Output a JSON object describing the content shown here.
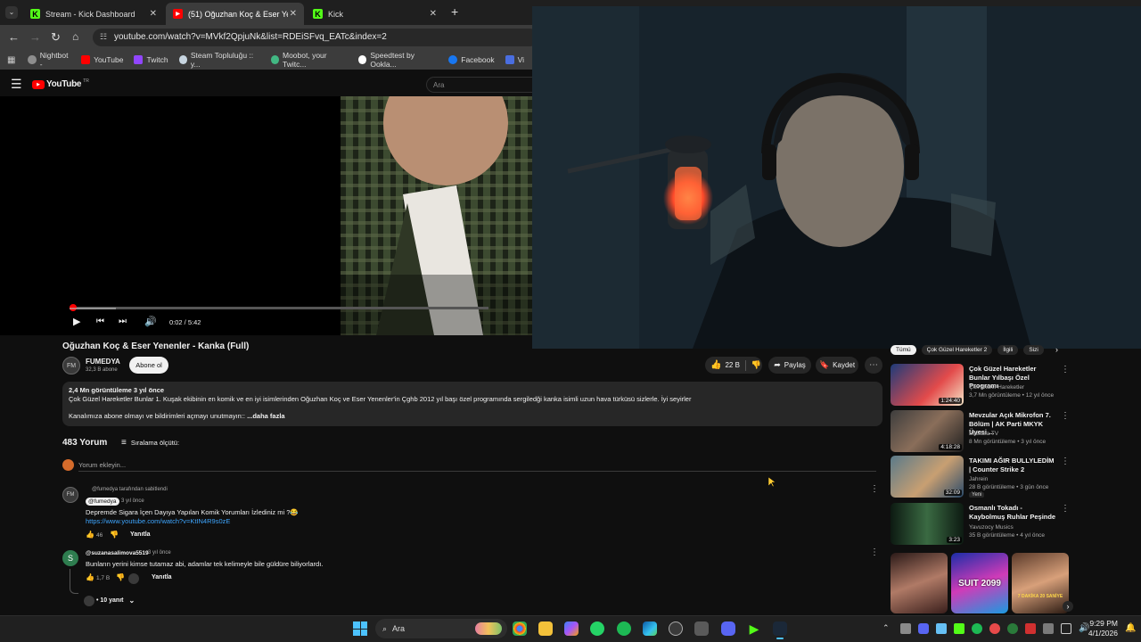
{
  "tabs": [
    {
      "label": "Stream - Kick Dashboard",
      "icon": "kick-icon"
    },
    {
      "label": "(51) Oğuzhan Koç & Eser Yenen",
      "icon": "youtube-icon"
    },
    {
      "label": "Kick",
      "icon": "kick-icon"
    }
  ],
  "new_tab": "+",
  "address": {
    "url": "youtube.com/watch?v=MVkf2QpjuNk&list=RDEiSFvq_EATc&index=2"
  },
  "bookmarks": [
    {
      "label": "Nightbot -",
      "color": "#8e8e8e"
    },
    {
      "label": "YouTube",
      "color": "#ff0000"
    },
    {
      "label": "Twitch",
      "color": "#9146ff"
    },
    {
      "label": "Steam Topluluğu :: y...",
      "color": "#c7d5e0"
    },
    {
      "label": "Moobot, your Twitc...",
      "color": "#42b883"
    },
    {
      "label": "Speedtest by Ookla...",
      "color": "#ffffff"
    },
    {
      "label": "Facebook",
      "color": "#1877f2"
    },
    {
      "label": "Vi",
      "color": "#4a6ee0"
    }
  ],
  "youtube": {
    "logo": "YouTube",
    "region": "TR",
    "search_placeholder": "Ara"
  },
  "player": {
    "time": "0:02 / 5:42",
    "progress": 0.006
  },
  "video": {
    "title": "Oğuzhan Koç & Eser Yenenler - Kanka (Full)",
    "channel": "FUMEDYA",
    "channel_avatar": "FM",
    "subscribers": "32,3 B abone",
    "subscribe": "Abone ol",
    "likes": "22 B",
    "share": "Paylaş",
    "save": "Kaydet",
    "desc_stats": "2,4 Mn görüntüleme  3 yıl önce",
    "desc_line1": "Çok Güzel Hareketler Bunlar 1. Kuşak ekibinin en komik ve en iyi isimlerinden Oğuzhan Koç ve Eser Yenenler'in Çghb 2012 yıl başı özel programında sergiledği kanka isimli uzun hava türküsü sizlerle. İyi seyirler",
    "desc_line2": "Kanalımıza abone olmayı ve bildirimleri açmayı unutmayın::  ",
    "desc_more": "...daha fazla"
  },
  "comments": {
    "count": "483 Yorum",
    "sort": "Sıralama ölçütü:",
    "add_placeholder": "Yorum ekleyin...",
    "items": [
      {
        "pinned": "@fumedya tarafından sabitlendi",
        "author": "@fumedya",
        "time": "3 yıl önce",
        "text": "Depremde Sigara İçen Dayıya Yapılan Komik Yorumları İzlediniz mi ?😂",
        "link": "https://www.youtube.com/watch?v=KtIN4R9s0zE",
        "likes": "46",
        "reply": "Yanıtla"
      },
      {
        "avatar": "S",
        "author": "@suzanasalimova5519",
        "time": "3 yıl önce",
        "text": "Bunların yerini kimse tutamaz abi, adamlar tek kelimeyle bile güldüre biliyorlardı.",
        "likes": "1,7 B",
        "reply": "Yanıtla",
        "replies": "• 10 yanıt"
      }
    ]
  },
  "chips": [
    "Tümü",
    "Çok Güzel Hareketler 2",
    "İlgili",
    "Sizi"
  ],
  "recommendations": [
    {
      "title": "Çok Güzel Hareketler Bunlar Yılbaşı Özel Programı",
      "channel": "Çok Güzel Hareketler",
      "meta": "3,7 Mn görüntüleme • 12 yıl önce",
      "duration": "1:24:40",
      "badge": ""
    },
    {
      "title": "Mevzular Açık Mikrofon 7. Bölüm | AK Parti MKYK Üyesi ...",
      "channel": "BaBaLa TV",
      "meta": "8 Mn görüntüleme • 3 yıl önce",
      "duration": "4:18:28",
      "badge": ""
    },
    {
      "title": "TAKIMI AĞIR BULLYLEDİM | Counter Strike 2",
      "channel": "Jahrein",
      "meta": "28 B görüntüleme • 3 gün önce",
      "duration": "32:09",
      "badge": "Yeni"
    },
    {
      "title": "Osmanlı Tokadı - Kaybolmuş Ruhlar Peşinde",
      "channel": "Yavuzocy Musics",
      "meta": "35 B görüntüleme • 4 yıl önce",
      "duration": "3:23",
      "badge": ""
    }
  ],
  "shorts_text": [
    "SUIT 2099",
    "7 DAKİKA 20 SANİYE"
  ],
  "taskbar": {
    "search": "Ara",
    "time": "9:29 PM",
    "date": "4/1/2026"
  }
}
